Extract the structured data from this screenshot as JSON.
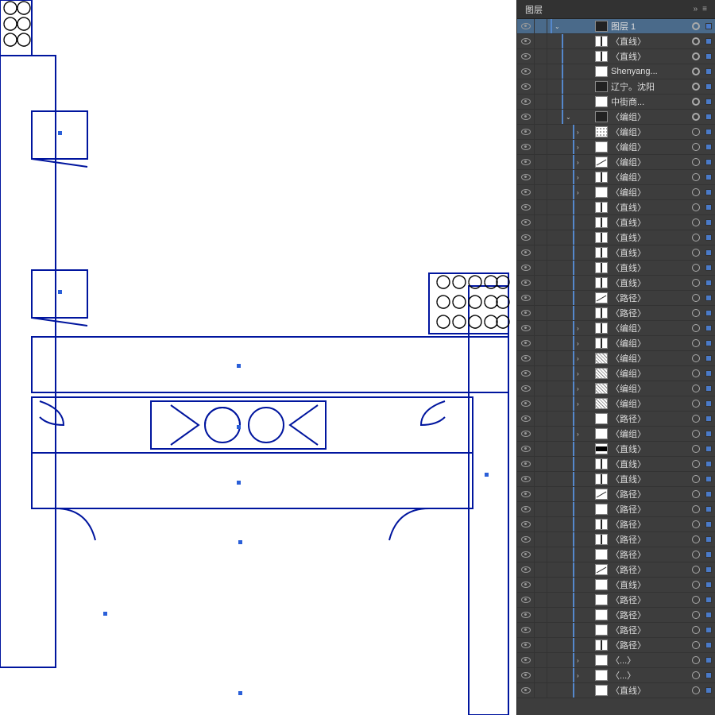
{
  "panel": {
    "title": "图层",
    "collapse_icon": "»",
    "menu_icon": "≡"
  },
  "layers": [
    {
      "depth": 0,
      "expand": "v",
      "thumb": "dark",
      "name": "图层 1",
      "target": "filled",
      "sel": true,
      "top": true
    },
    {
      "depth": 1,
      "expand": "",
      "thumb": "line-v",
      "name": "〈直线〉",
      "target": "filled",
      "sel": true
    },
    {
      "depth": 1,
      "expand": "",
      "thumb": "line-v",
      "name": "〈直线〉",
      "target": "filled",
      "sel": true
    },
    {
      "depth": 1,
      "expand": "",
      "thumb": "white",
      "name": "Shenyang...",
      "target": "filled",
      "sel": true
    },
    {
      "depth": 1,
      "expand": "",
      "thumb": "dark",
      "name": "辽宁。沈阳",
      "target": "filled",
      "sel": true
    },
    {
      "depth": 1,
      "expand": "",
      "thumb": "white",
      "name": "中街商...",
      "target": "filled",
      "sel": true
    },
    {
      "depth": 1,
      "expand": "v",
      "thumb": "dark",
      "name": "〈编组〉",
      "target": "filled",
      "sel": true
    },
    {
      "depth": 2,
      "expand": ">",
      "thumb": "dots",
      "name": "〈编组〉",
      "target": "ring",
      "sel": true
    },
    {
      "depth": 2,
      "expand": ">",
      "thumb": "white",
      "name": "〈编组〉",
      "target": "ring",
      "sel": true
    },
    {
      "depth": 2,
      "expand": ">",
      "thumb": "line-d",
      "name": "〈编组〉",
      "target": "ring",
      "sel": true
    },
    {
      "depth": 2,
      "expand": ">",
      "thumb": "line-v",
      "name": "〈编组〉",
      "target": "ring",
      "sel": true
    },
    {
      "depth": 2,
      "expand": ">",
      "thumb": "white",
      "name": "〈编组〉",
      "target": "ring",
      "sel": true
    },
    {
      "depth": 2,
      "expand": "",
      "thumb": "line-v",
      "name": "〈直线〉",
      "target": "ring",
      "sel": true
    },
    {
      "depth": 2,
      "expand": "",
      "thumb": "line-v",
      "name": "〈直线〉",
      "target": "ring",
      "sel": true
    },
    {
      "depth": 2,
      "expand": "",
      "thumb": "line-v",
      "name": "〈直线〉",
      "target": "ring",
      "sel": true
    },
    {
      "depth": 2,
      "expand": "",
      "thumb": "line-v",
      "name": "〈直线〉",
      "target": "ring",
      "sel": true
    },
    {
      "depth": 2,
      "expand": "",
      "thumb": "line-v",
      "name": "〈直线〉",
      "target": "ring",
      "sel": true
    },
    {
      "depth": 2,
      "expand": "",
      "thumb": "line-v",
      "name": "〈直线〉",
      "target": "ring",
      "sel": true
    },
    {
      "depth": 2,
      "expand": "",
      "thumb": "line-d",
      "name": "〈路径〉",
      "target": "ring",
      "sel": true
    },
    {
      "depth": 2,
      "expand": "",
      "thumb": "line-v",
      "name": "〈路径〉",
      "target": "ring",
      "sel": true
    },
    {
      "depth": 2,
      "expand": ">",
      "thumb": "line-v",
      "name": "〈编组〉",
      "target": "ring",
      "sel": true
    },
    {
      "depth": 2,
      "expand": ">",
      "thumb": "line-v",
      "name": "〈编组〉",
      "target": "ring",
      "sel": true
    },
    {
      "depth": 2,
      "expand": ">",
      "thumb": "pattern",
      "name": "〈编组〉",
      "target": "ring",
      "sel": true
    },
    {
      "depth": 2,
      "expand": ">",
      "thumb": "pattern",
      "name": "〈编组〉",
      "target": "ring",
      "sel": true
    },
    {
      "depth": 2,
      "expand": ">",
      "thumb": "pattern",
      "name": "〈编组〉",
      "target": "ring",
      "sel": true
    },
    {
      "depth": 2,
      "expand": ">",
      "thumb": "pattern",
      "name": "〈编组〉",
      "target": "ring",
      "sel": true
    },
    {
      "depth": 2,
      "expand": "",
      "thumb": "white",
      "name": "〈路径〉",
      "target": "ring",
      "sel": true
    },
    {
      "depth": 2,
      "expand": ">",
      "thumb": "white",
      "name": "〈编组〉",
      "target": "ring",
      "sel": true
    },
    {
      "depth": 2,
      "expand": "",
      "thumb": "bigline",
      "name": "〈直线〉",
      "target": "ring",
      "sel": true
    },
    {
      "depth": 2,
      "expand": "",
      "thumb": "line-v",
      "name": "〈直线〉",
      "target": "ring",
      "sel": true
    },
    {
      "depth": 2,
      "expand": "",
      "thumb": "line-v",
      "name": "〈直线〉",
      "target": "ring",
      "sel": true
    },
    {
      "depth": 2,
      "expand": "",
      "thumb": "line-d",
      "name": "〈路径〉",
      "target": "ring",
      "sel": true
    },
    {
      "depth": 2,
      "expand": "",
      "thumb": "white",
      "name": "〈路径〉",
      "target": "ring",
      "sel": true
    },
    {
      "depth": 2,
      "expand": "",
      "thumb": "line-v",
      "name": "〈路径〉",
      "target": "ring",
      "sel": true
    },
    {
      "depth": 2,
      "expand": "",
      "thumb": "line-v",
      "name": "〈路径〉",
      "target": "ring",
      "sel": true
    },
    {
      "depth": 2,
      "expand": "",
      "thumb": "white",
      "name": "〈路径〉",
      "target": "ring",
      "sel": true
    },
    {
      "depth": 2,
      "expand": "",
      "thumb": "line-d",
      "name": "〈路径〉",
      "target": "ring",
      "sel": true
    },
    {
      "depth": 2,
      "expand": "",
      "thumb": "white",
      "name": "〈直线〉",
      "target": "ring",
      "sel": true
    },
    {
      "depth": 2,
      "expand": "",
      "thumb": "white",
      "name": "〈路径〉",
      "target": "ring",
      "sel": true
    },
    {
      "depth": 2,
      "expand": "",
      "thumb": "white",
      "name": "〈路径〉",
      "target": "ring",
      "sel": true
    },
    {
      "depth": 2,
      "expand": "",
      "thumb": "white",
      "name": "〈路径〉",
      "target": "ring",
      "sel": true
    },
    {
      "depth": 2,
      "expand": "",
      "thumb": "line-v",
      "name": "〈路径〉",
      "target": "ring",
      "sel": true
    },
    {
      "depth": 2,
      "expand": ">",
      "thumb": "white",
      "name": "〈...〉",
      "target": "ring",
      "sel": true
    },
    {
      "depth": 2,
      "expand": ">",
      "thumb": "white",
      "name": "〈...〉",
      "target": "ring",
      "sel": true
    },
    {
      "depth": 2,
      "expand": "",
      "thumb": "white",
      "name": "〈直线〉",
      "target": "ring",
      "sel": true
    }
  ]
}
